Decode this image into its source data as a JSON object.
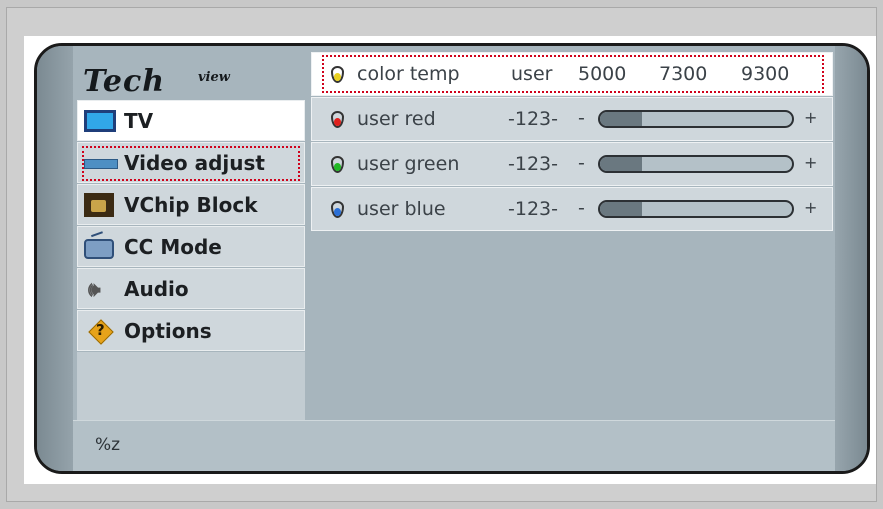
{
  "logo": {
    "main": "Tech",
    "sup": "view"
  },
  "menu": {
    "items": [
      {
        "label": "TV",
        "icon": "tv-icon",
        "active": true
      },
      {
        "label": "Video adjust",
        "icon": "video-adjust-icon",
        "highlighted": true
      },
      {
        "label": "VChip Block",
        "icon": "vchip-lock-icon"
      },
      {
        "label": "CC Mode",
        "icon": "closed-caption-tv-icon"
      },
      {
        "label": "Audio",
        "icon": "speaker-icon"
      },
      {
        "label": "Options",
        "icon": "question-diamond-icon"
      }
    ]
  },
  "color_temp": {
    "label": "color temp",
    "options": [
      "user",
      "5000",
      "7300",
      "9300"
    ],
    "icon": "drop-icon-yellow",
    "drop_color": "#e8d020"
  },
  "rows": [
    {
      "label": "user red",
      "value": "-123-",
      "minus": "-",
      "plus": "+",
      "level": 0.22,
      "icon": "drop-icon-red",
      "drop_color": "#e0201d"
    },
    {
      "label": "user green",
      "value": "-123-",
      "minus": "-",
      "plus": "+",
      "level": 0.22,
      "icon": "drop-icon-green",
      "drop_color": "#22b825"
    },
    {
      "label": "user blue",
      "value": "-123-",
      "minus": "-",
      "plus": "+",
      "level": 0.22,
      "icon": "drop-icon-blue",
      "drop_color": "#2a6fd6"
    }
  ],
  "status": {
    "text": "%z"
  },
  "colors": {
    "highlight": "#d0021b",
    "screen_bg": "#a7b5bd"
  }
}
